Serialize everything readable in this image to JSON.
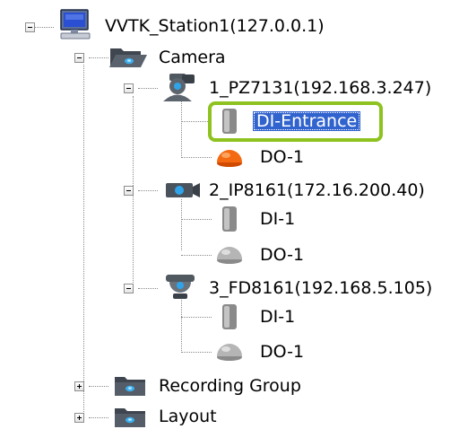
{
  "tree": {
    "station": {
      "label": "VVTK_Station1(127.0.0.1)",
      "icon": "monitor-icon"
    },
    "camera_folder": {
      "label": "Camera",
      "icon": "open-folder-icon"
    },
    "cameras": [
      {
        "label": "1_PZ7131(192.168.3.247)",
        "icon": "ptz-camera-icon",
        "children": [
          {
            "label": "DI-Entrance",
            "icon": "digital-input-icon",
            "selected": true
          },
          {
            "label": "DO-1",
            "icon": "digital-output-active-icon"
          }
        ]
      },
      {
        "label": "2_IP8161(172.16.200.40)",
        "icon": "box-camera-icon",
        "children": [
          {
            "label": "DI-1",
            "icon": "digital-input-icon"
          },
          {
            "label": "DO-1",
            "icon": "digital-output-icon"
          }
        ]
      },
      {
        "label": "3_FD8161(192.168.5.105)",
        "icon": "dome-camera-icon",
        "children": [
          {
            "label": "DI-1",
            "icon": "digital-input-icon"
          },
          {
            "label": "DO-1",
            "icon": "digital-output-icon"
          }
        ]
      }
    ],
    "recording_group": {
      "label": "Recording Group",
      "icon": "folder-icon"
    },
    "layout": {
      "label": "Layout",
      "icon": "folder-icon"
    }
  },
  "colors": {
    "selection_bg": "#3163ce",
    "highlight_border": "#8dc21f",
    "tree_line": "#8a8a8a"
  }
}
